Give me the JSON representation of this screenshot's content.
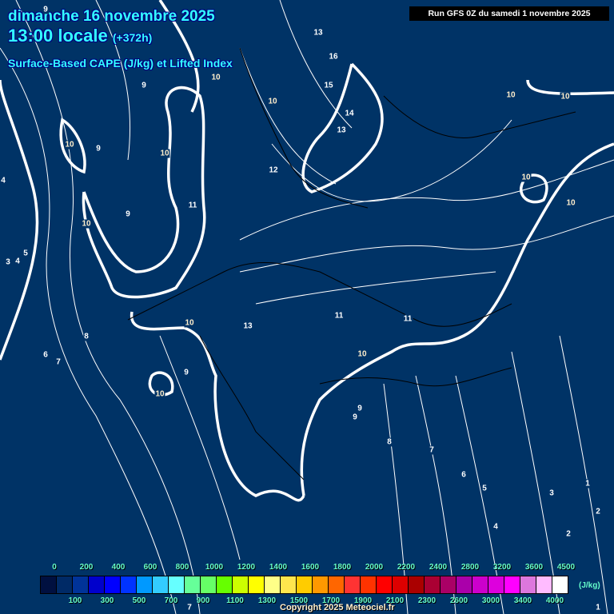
{
  "header": {
    "date": "dimanche 16 novembre 2025",
    "time": "13:00 locale",
    "lead": "(+372h)",
    "product": "Surface-Based CAPE (J/kg) et Lifted Index",
    "run": "Run GFS 0Z du samedi 1 novembre 2025"
  },
  "contour_labels": [
    "9",
    "13",
    "16",
    "10",
    "9",
    "15",
    "10",
    "10",
    "10",
    "14",
    "13",
    "10",
    "9",
    "10",
    "12",
    "10",
    "10",
    "11",
    "9",
    "10",
    "4",
    "5",
    "3",
    "4",
    "8",
    "10",
    "13",
    "11",
    "11",
    "10",
    "6",
    "7",
    "9",
    "10",
    "9",
    "9",
    "8",
    "7",
    "6",
    "5",
    "3",
    "1",
    "2",
    "4",
    "2",
    "1",
    "7"
  ],
  "legend": {
    "colors": [
      "#001040",
      "#002a66",
      "#003399",
      "#0000cc",
      "#0000ff",
      "#0033ff",
      "#0099ff",
      "#33ccff",
      "#66ffff",
      "#66ff99",
      "#66ff66",
      "#66ff00",
      "#ccff00",
      "#ffff00",
      "#ffff88",
      "#ffe64d",
      "#ffcc00",
      "#ff9900",
      "#ff6600",
      "#ff3333",
      "#ff3300",
      "#ff0000",
      "#dd0000",
      "#aa0000",
      "#aa0033",
      "#aa0066",
      "#aa00aa",
      "#cc00cc",
      "#dd00dd",
      "#ff00ff",
      "#dd77dd",
      "#ffbbff",
      "#ffffff"
    ],
    "top_ticks": [
      "0",
      "200",
      "400",
      "600",
      "800",
      "1000",
      "1200",
      "1400",
      "1600",
      "1800",
      "2000",
      "2200",
      "2400",
      "2800",
      "3200",
      "3600",
      "4500"
    ],
    "bottom_ticks": [
      "100",
      "300",
      "500",
      "700",
      "900",
      "1100",
      "1300",
      "1500",
      "1700",
      "1900",
      "2100",
      "2300",
      "2600",
      "3000",
      "3400",
      "4000"
    ],
    "unit": "(J/kg)"
  },
  "copyright": "Copyright 2025 Meteociel.fr"
}
